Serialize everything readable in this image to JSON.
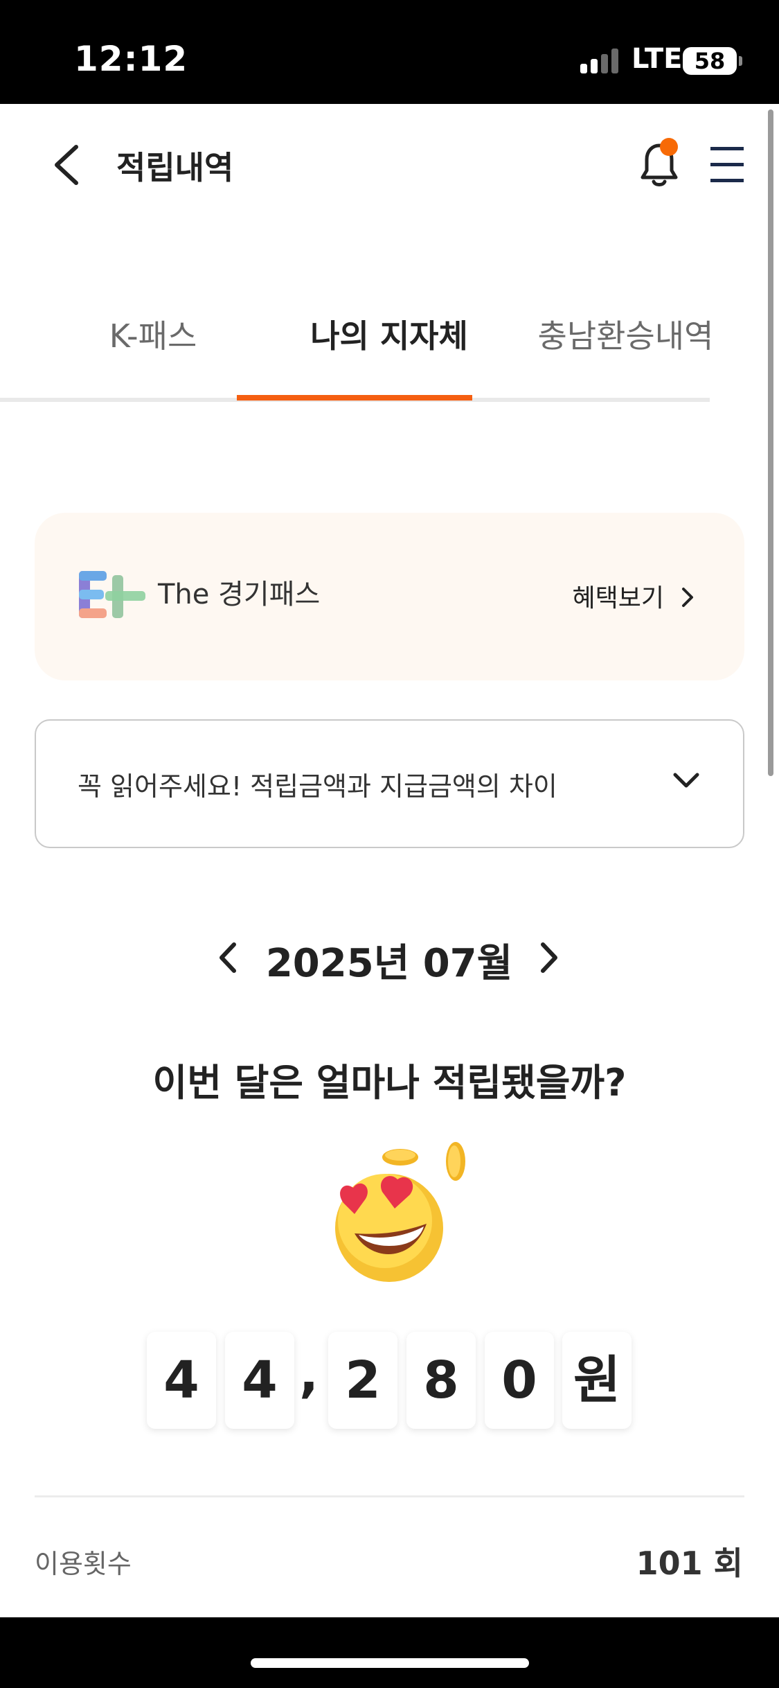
{
  "status_bar": {
    "time": "12:12",
    "network": "LTE",
    "battery": "58"
  },
  "header": {
    "title": "적립내역",
    "back_icon": "chevron-left-icon",
    "bell_icon": "bell-icon",
    "menu_icon": "hamburger-menu-icon",
    "notification_dot_color": "#f76a06"
  },
  "tabs": [
    {
      "label": "K-패스",
      "active": false
    },
    {
      "label": "나의 지자체",
      "active": true
    },
    {
      "label": "충남환승내역",
      "active": false
    }
  ],
  "accent_color": "#f55f11",
  "promo": {
    "logo_text": "The 경기패스",
    "benefit_label": "혜택보기"
  },
  "notice": {
    "text": "꼭 읽어주세요! 적립금액과 지급금액의 차이"
  },
  "month_nav": {
    "label": "2025년 07월"
  },
  "question": "이번 달은 얼마나 적립됐을까?",
  "amount": {
    "chars": [
      "4",
      "4",
      ",",
      "2",
      "8",
      "0",
      "원"
    ]
  },
  "usage": {
    "label": "이용횟수",
    "value": "101 회"
  }
}
